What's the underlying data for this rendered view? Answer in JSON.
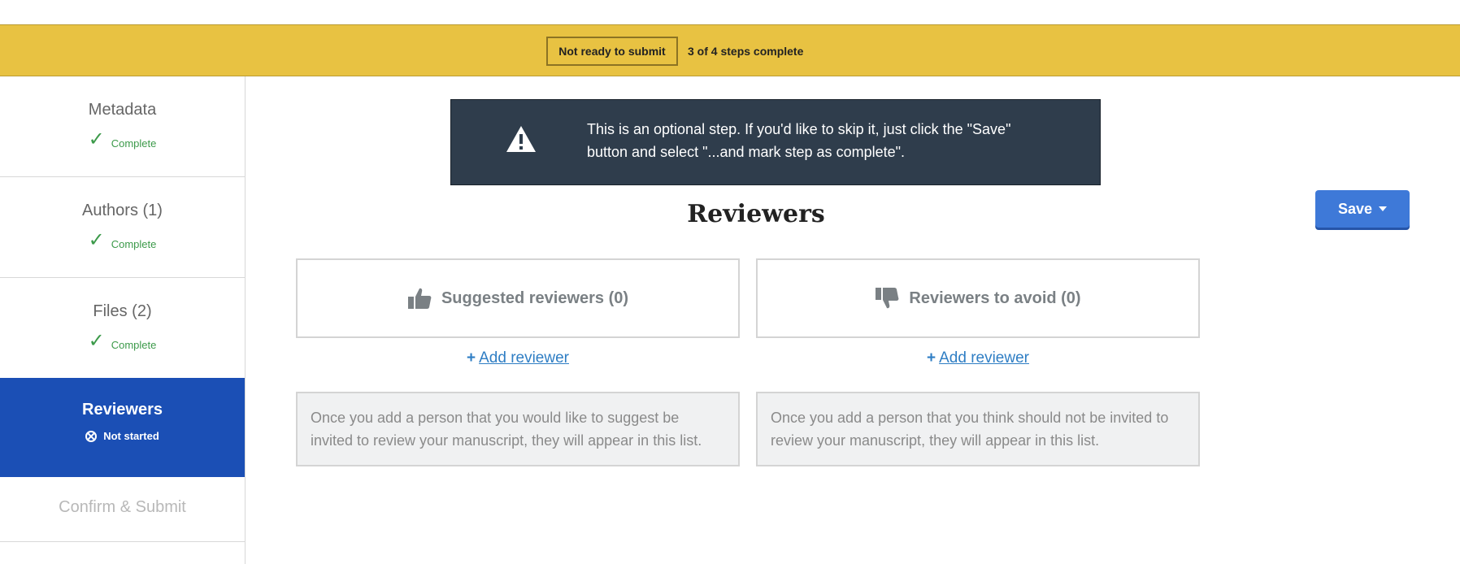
{
  "statusbar": {
    "badge": "Not ready to submit",
    "steps": "3 of 4  steps complete"
  },
  "sidebar": {
    "items": [
      {
        "label": "Metadata",
        "status": "Complete"
      },
      {
        "label": "Authors (1)",
        "status": "Complete"
      },
      {
        "label": "Files (2)",
        "status": "Complete"
      },
      {
        "label": "Reviewers",
        "status": "Not started"
      },
      {
        "label": "Confirm & Submit"
      }
    ]
  },
  "notice": {
    "text": "This is an optional step. If you'd like to skip it, just click the \"Save\" button and select \"...and mark step as complete\"."
  },
  "main": {
    "title": "Reviewers",
    "save_label": "Save",
    "suggested": {
      "heading": "Suggested reviewers (0)",
      "add_label": "Add reviewer",
      "empty": "Once you add a person that you would like to suggest be invited to review your manuscript, they will appear in this list."
    },
    "avoid": {
      "heading": "Reviewers to avoid (0)",
      "add_label": "Add reviewer",
      "empty": "Once you add a person that you think should not be invited to review your manuscript, they will appear in this list."
    }
  },
  "colors": {
    "statusbar": "#e8c242",
    "active_nav": "#1b4fb5",
    "complete": "#3c9a4a",
    "notice_bg": "#2f3d4c",
    "save_button": "#3e79d8",
    "link": "#2f7ec4"
  },
  "icons": [
    "check-icon",
    "not-started-icon",
    "warning-icon",
    "thumbs-up-icon",
    "thumbs-down-icon",
    "plus-icon",
    "caret-down-icon"
  ]
}
